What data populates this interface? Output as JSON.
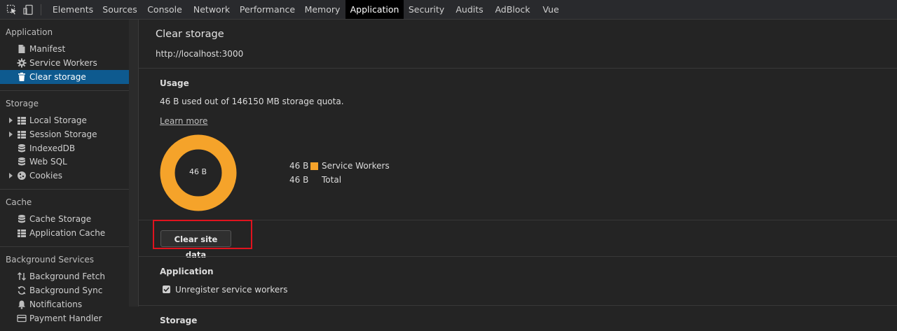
{
  "toolbar": {
    "tabs": [
      "Elements",
      "Sources",
      "Console",
      "Network",
      "Performance",
      "Memory",
      "Application",
      "Security",
      "Audits",
      "AdBlock",
      "Vue"
    ],
    "active_tab": "Application"
  },
  "sidebar": {
    "sections": [
      {
        "title": "Application",
        "items": [
          {
            "label": "Manifest",
            "icon": "document-icon"
          },
          {
            "label": "Service Workers",
            "icon": "gear-icon"
          },
          {
            "label": "Clear storage",
            "icon": "trash-icon",
            "selected": true
          }
        ]
      },
      {
        "title": "Storage",
        "items": [
          {
            "label": "Local Storage",
            "icon": "grid-icon",
            "expandable": true
          },
          {
            "label": "Session Storage",
            "icon": "grid-icon",
            "expandable": true
          },
          {
            "label": "IndexedDB",
            "icon": "database-icon"
          },
          {
            "label": "Web SQL",
            "icon": "database-icon"
          },
          {
            "label": "Cookies",
            "icon": "cookie-icon",
            "expandable": true
          }
        ]
      },
      {
        "title": "Cache",
        "items": [
          {
            "label": "Cache Storage",
            "icon": "database-icon"
          },
          {
            "label": "Application Cache",
            "icon": "grid-icon"
          }
        ]
      },
      {
        "title": "Background Services",
        "items": [
          {
            "label": "Background Fetch",
            "icon": "arrows-updown-icon"
          },
          {
            "label": "Background Sync",
            "icon": "sync-icon"
          },
          {
            "label": "Notifications",
            "icon": "bell-icon"
          },
          {
            "label": "Payment Handler",
            "icon": "card-icon"
          }
        ]
      }
    ]
  },
  "main": {
    "title": "Clear storage",
    "origin": "http://localhost:3000",
    "usage": {
      "title": "Usage",
      "summary": "46 B used out of 146150 MB storage quota.",
      "learn_more": "Learn more",
      "donut_label": "46 B",
      "legend": [
        {
          "value": "46 B",
          "name": "Service Workers",
          "color": "#f5a32a"
        },
        {
          "value": "46 B",
          "name": "Total"
        }
      ]
    },
    "clear_button": "Clear site data",
    "application_section": {
      "title": "Application",
      "checkbox_label": "Unregister service workers",
      "checked": true
    },
    "storage_section_title": "Storage"
  },
  "colors": {
    "accent_selected": "#0e5a8f",
    "donut": "#f5a32a",
    "highlight": "#e0131e"
  }
}
